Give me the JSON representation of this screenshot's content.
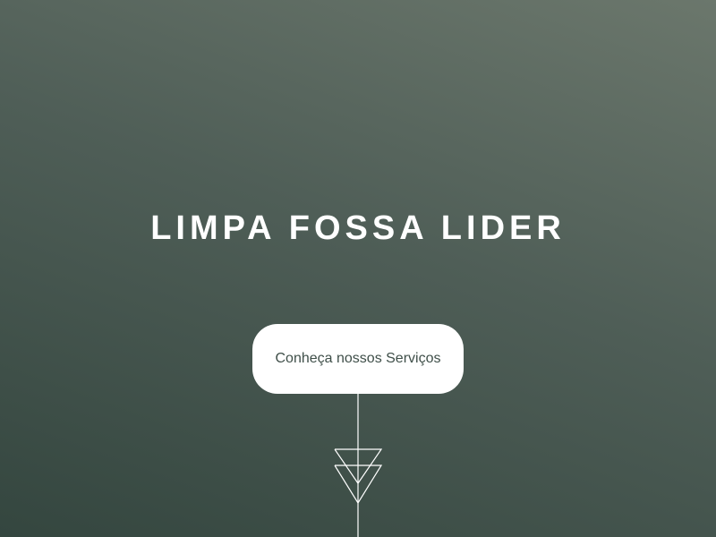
{
  "hero": {
    "title": "LIMPA FOSSA LIDER",
    "cta_label": "Conheça nossos Serviços"
  },
  "icons": {
    "scroll_indicator": "double-triangle-down-arrow-icon"
  },
  "colors": {
    "background_top": "#6b776c",
    "background_bottom": "#34463f",
    "text": "#ffffff",
    "button_bg": "#ffffff",
    "button_text": "#3f4f49"
  }
}
